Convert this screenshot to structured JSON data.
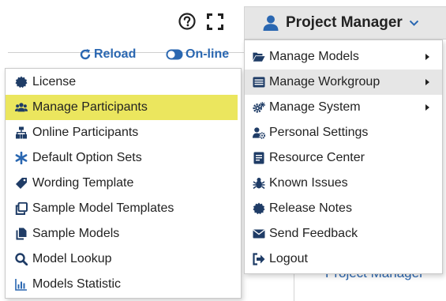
{
  "header": {
    "help_icon": "question-circle-icon",
    "fullscreen_icon": "fullscreen-icon",
    "user_icon": "user-icon",
    "user_label": "Project Manager",
    "caret_icon": "caret-down-icon"
  },
  "toolbar": {
    "reload_label": "Reload",
    "online_label": "On-line"
  },
  "background": {
    "project_text": "Project Manager"
  },
  "left_menu": {
    "items": [
      {
        "label": "License",
        "icon": "badge-icon"
      },
      {
        "label": "Manage Participants",
        "icon": "users-icon",
        "highlighted": true
      },
      {
        "label": "Online Participants",
        "icon": "sitemap-icon"
      },
      {
        "label": "Default Option Sets",
        "icon": "asterisk-icon"
      },
      {
        "label": "Wording Template",
        "icon": "tag-icon"
      },
      {
        "label": "Sample Model Templates",
        "icon": "clone-icon"
      },
      {
        "label": "Sample Models",
        "icon": "copy-icon"
      },
      {
        "label": "Model Lookup",
        "icon": "search-icon"
      },
      {
        "label": "Models Statistic",
        "icon": "bar-chart-icon"
      }
    ]
  },
  "right_menu": {
    "items": [
      {
        "label": "Manage Models",
        "icon": "folder-open-icon",
        "has_submenu": true
      },
      {
        "label": "Manage Workgroup",
        "icon": "list-icon",
        "has_submenu": true,
        "active": true
      },
      {
        "label": "Manage System",
        "icon": "cogs-icon",
        "has_submenu": true
      },
      {
        "label": "Personal Settings",
        "icon": "user-cog-icon",
        "has_submenu": false
      },
      {
        "label": "Resource Center",
        "icon": "book-icon",
        "has_submenu": false
      },
      {
        "label": "Known Issues",
        "icon": "bug-icon",
        "has_submenu": false
      },
      {
        "label": "Release Notes",
        "icon": "certificate-icon",
        "has_submenu": false
      },
      {
        "label": "Send Feedback",
        "icon": "envelope-icon",
        "has_submenu": false
      },
      {
        "label": "Logout",
        "icon": "sign-out-icon",
        "has_submenu": false
      }
    ]
  },
  "colors": {
    "accent_blue": "#2a67b1",
    "highlight_yellow": "#ebe65e",
    "active_gray": "#e6e6e6",
    "icon_dark": "#1f3c66"
  }
}
